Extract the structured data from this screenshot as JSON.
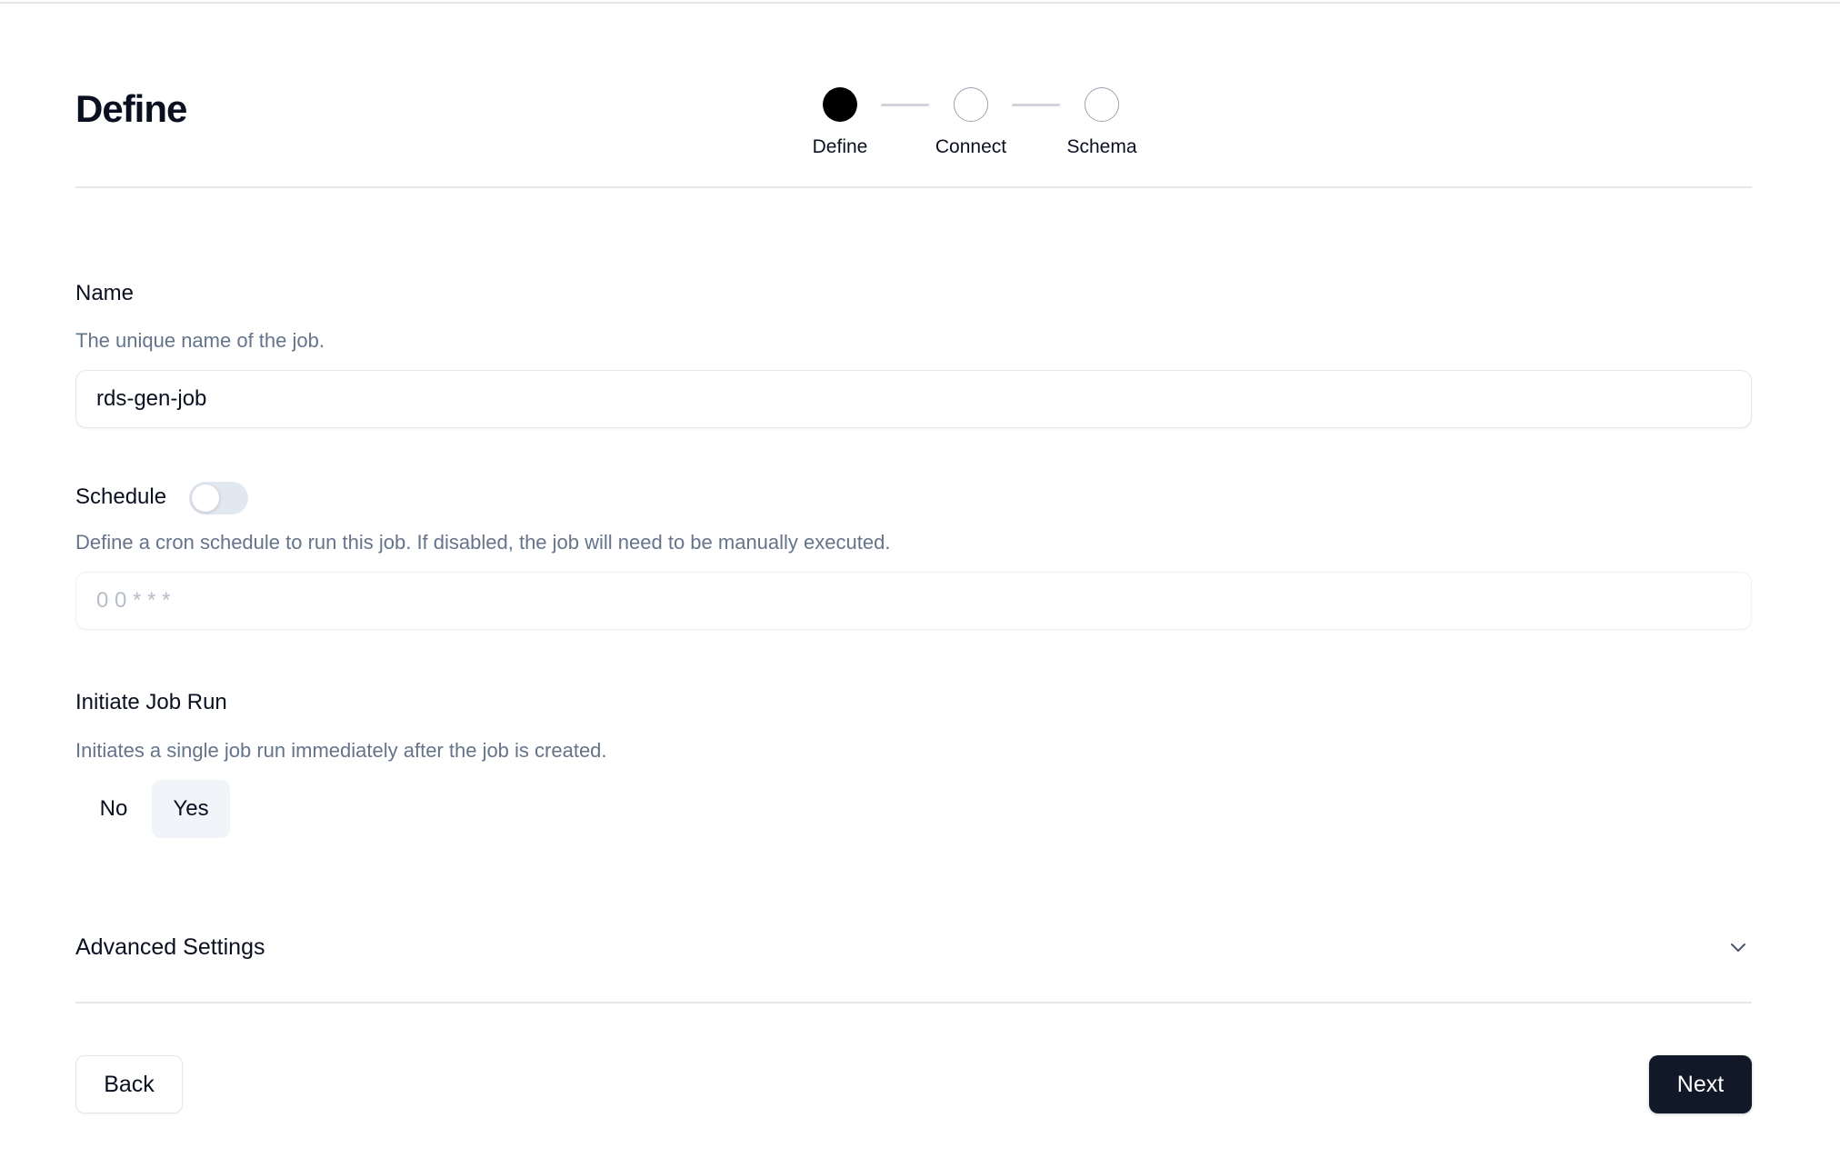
{
  "header": {
    "title": "Define"
  },
  "stepper": {
    "current_step": 1,
    "steps": [
      {
        "label": "Define",
        "state": "active"
      },
      {
        "label": "Connect",
        "state": "pending"
      },
      {
        "label": "Schema",
        "state": "pending"
      }
    ]
  },
  "form": {
    "name": {
      "label": "Name",
      "description": "The unique name of the job.",
      "value": "rds-gen-job"
    },
    "schedule": {
      "label": "Schedule",
      "enabled": false,
      "description": "Define a cron schedule to run this job. If disabled, the job will need to be manually executed.",
      "placeholder": "0 0 * * *",
      "value": ""
    },
    "initiate_job_run": {
      "label": "Initiate Job Run",
      "description": "Initiates a single job run immediately after the job is created.",
      "options": [
        "No",
        "Yes"
      ],
      "selected": "Yes"
    },
    "advanced_settings": {
      "label": "Advanced Settings",
      "expanded": false,
      "icon": "chevron-down-icon"
    }
  },
  "footer": {
    "back_label": "Back",
    "next_label": "Next"
  },
  "colors": {
    "primary_button": "#111827",
    "muted_text": "#64748b",
    "border": "#e2e8f0"
  }
}
